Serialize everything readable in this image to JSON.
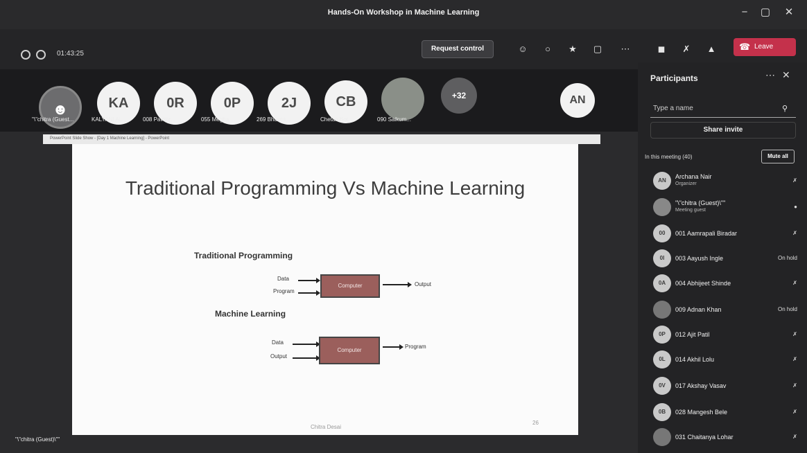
{
  "window": {
    "title": "Hands-On Workshop in Machine Learning",
    "buttons": [
      "−",
      "▢",
      "✕"
    ]
  },
  "toolbar": {
    "timer": "01:43:25",
    "request_control": "Request control",
    "leave": "Leave",
    "icons": [
      "people-icon",
      "chat-icon",
      "react-icon",
      "view-icon",
      "more-icon",
      "camera-off-icon",
      "mic-off-icon",
      "share-icon"
    ]
  },
  "strip": {
    "participants": [
      {
        "initials": "",
        "name": "\"\\\"chitra (Guest..."
      },
      {
        "initials": "KA",
        "name": "KALYANI AL..."
      },
      {
        "initials": "0R",
        "name": "008 Pavithr..."
      },
      {
        "initials": "0P",
        "name": "055 Megha ..."
      },
      {
        "initials": "2J",
        "name": "269 Bhaves..."
      },
      {
        "initials": "CB",
        "name": "Chetan Bot..."
      },
      {
        "initials": "",
        "name": "090 Saikum..."
      },
      {
        "initials": "+32",
        "name": ""
      },
      {
        "initials": "AN",
        "name": ""
      }
    ]
  },
  "slide": {
    "window_caption": "PowerPoint Slide Show - [Day 1 Machine Learning] - PowerPoint",
    "title": "Traditional Programming Vs Machine Learning",
    "trad_label": "Traditional Programming",
    "ml_label": "Machine Learning",
    "trad_in1": "Data",
    "trad_in2": "Program",
    "trad_box": "Computer",
    "trad_out": "Output",
    "ml_in1": "Data",
    "ml_in2": "Output",
    "ml_box": "Computer",
    "ml_out": "Program",
    "footer": "Chitra Desai",
    "page": "26"
  },
  "self_label": "\"\\\"chitra (Guest)\\\"\"",
  "panel": {
    "title": "Participants",
    "search_placeholder": "Type a name",
    "share_invite": "Share invite",
    "section": "In this meeting (40)",
    "mute_all": "Mute all",
    "people": [
      {
        "initials": "AN",
        "name": "Archana Nair",
        "role": "Organizer",
        "status": "mic-off"
      },
      {
        "initials": "",
        "name": "\"\\\"chitra (Guest)\\\"\"",
        "role": "Meeting guest",
        "status": "mic-on"
      },
      {
        "initials": "00",
        "name": "001 Aamrapali Biradar",
        "role": "",
        "status": "mic-off"
      },
      {
        "initials": "0I",
        "name": "003 Aayush Ingle",
        "role": "",
        "status": "On hold"
      },
      {
        "initials": "0A",
        "name": "004 Abhijeet Shinde",
        "role": "",
        "status": "mic-off"
      },
      {
        "initials": "",
        "name": "009 Adnan Khan",
        "role": "",
        "status": "On hold"
      },
      {
        "initials": "0P",
        "name": "012 Ajit Patil",
        "role": "",
        "status": "mic-off"
      },
      {
        "initials": "0L",
        "name": "014 Akhil Lolu",
        "role": "",
        "status": "mic-off"
      },
      {
        "initials": "0V",
        "name": "017 Akshay Vasav",
        "role": "",
        "status": "mic-off"
      },
      {
        "initials": "0B",
        "name": "028 Mangesh Bele",
        "role": "",
        "status": "mic-off"
      },
      {
        "initials": "",
        "name": "031 Chaitanya Lohar",
        "role": "",
        "status": "mic-off"
      }
    ]
  }
}
